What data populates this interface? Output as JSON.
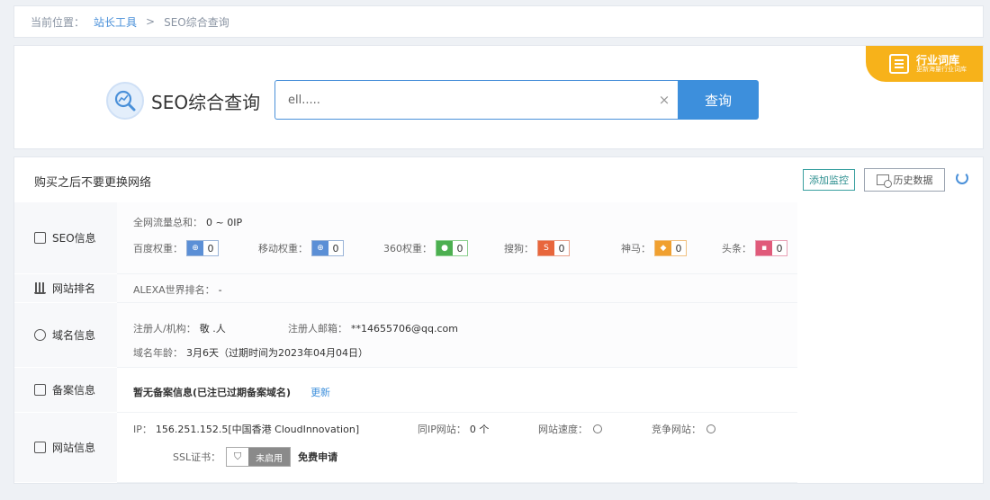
{
  "breadcrumb": {
    "prefix": "当前位置：",
    "items": [
      "站长工具",
      "SEO综合查询"
    ],
    "separator": ">"
  },
  "search": {
    "title": "SEO综合查询",
    "input_value": "ell.....",
    "clear": "×",
    "button": "查询",
    "badge_title": "行业词库",
    "badge_sub": "更新海量行业词库"
  },
  "info": {
    "title": "购买之后不要更换网络",
    "monitor_button": "添加监控",
    "history_button": "历史数据",
    "seo": {
      "label": "SEO信息",
      "traffic_label": "全网流量总和：",
      "traffic_value": "0 ~ 0IP",
      "ranks": [
        {
          "label": "百度权重：",
          "value": "0",
          "color": "#5b8fd6"
        },
        {
          "label": "移动权重：",
          "value": "0",
          "color": "#5b8fd6"
        },
        {
          "label": "360权重：",
          "value": "0",
          "color": "#4caf50"
        },
        {
          "label": "搜狗：",
          "value": "0",
          "color": "#e8663c"
        },
        {
          "label": "神马：",
          "value": "0",
          "color": "#f0a030"
        },
        {
          "label": "头条：",
          "value": "0",
          "color": "#e05a7a"
        }
      ]
    },
    "rank": {
      "label": "网站排名",
      "alexa_label": "ALEXA世界排名：",
      "alexa_value": "-"
    },
    "domain": {
      "label": "域名信息",
      "registrant_label": "注册人/机构：",
      "registrant_value": "敬 .人",
      "email_label": "注册人邮箱：",
      "email_value": "**14655706@qq.com",
      "age_label": "域名年龄：",
      "age_value": "3月6天（过期时间为2023年04月04日）"
    },
    "icp": {
      "label": "备案信息",
      "value": "暂无备案信息(已注已过期备案域名)",
      "update": "更新"
    },
    "site": {
      "label": "网站信息",
      "ip_label": "IP：",
      "ip_value": "156.251.152.5[中国香港 CloudInnovation]",
      "sameip_label": "同IP网站：",
      "sameip_value": "0 个",
      "speed_label": "网站速度：",
      "similar_label": "竞争网站：",
      "ssl_label": "SSL证书：",
      "ssl_button": "未启用",
      "ssl_free": "免费申请"
    }
  }
}
